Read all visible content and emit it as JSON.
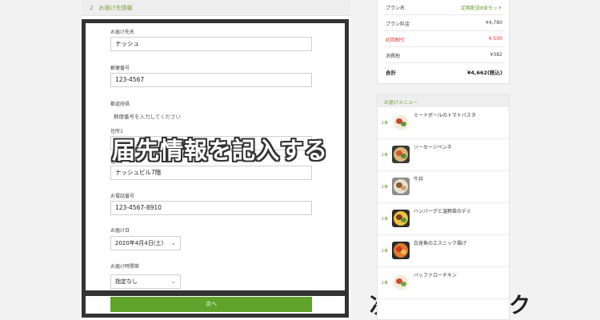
{
  "step": {
    "title": "2　お届け先情報"
  },
  "form": {
    "name_label": "お届け先名",
    "name_value": "ナッシュ",
    "zip_label": "郵便番号",
    "zip_value": "123-4567",
    "pref_label": "都道府県",
    "pref_placeholder": "郵便番号を入力してください",
    "addr1_label": "住所1",
    "addr2_label": "住所2",
    "addr2_value": "ナッシュビル7階",
    "phone_label": "お電話番号",
    "phone_value": "123-4567-8910",
    "date_label": "お届け日",
    "date_value": "2020年4月4日(土)",
    "time_label": "お届け時間帯",
    "time_value": "指定なし",
    "next_label": "次へ"
  },
  "annotations": {
    "form_caption": "届先情報を記入する",
    "click_caption": "次へをクリック"
  },
  "summary": {
    "plan_label": "プラン名",
    "plan_value": "定期配送8食セット",
    "price_label": "プラン料金",
    "price_value": "¥4,780",
    "discount_label": "初回割引",
    "discount_value": "¥-500",
    "tax_label": "消費税",
    "tax_value": "¥382",
    "total_label": "合計",
    "total_value": "¥4,662(税込)"
  },
  "menu": {
    "title": "お届けメニュー",
    "items": [
      {
        "qty": "1食",
        "name": "ミートボールのトマトパスタ"
      },
      {
        "qty": "1食",
        "name": "ソーセージペンネ"
      },
      {
        "qty": "1食",
        "name": "牛丼"
      },
      {
        "qty": "1食",
        "name": "ハンバーグと温野菜のデミ"
      },
      {
        "qty": "1食",
        "name": "白身魚のエスニック揚げ"
      },
      {
        "qty": "1食",
        "name": "バッファローチキン"
      }
    ]
  },
  "colors": {
    "accent_green": "#5fa32a",
    "discount_red": "#d33333",
    "frame_dark": "#333333"
  }
}
